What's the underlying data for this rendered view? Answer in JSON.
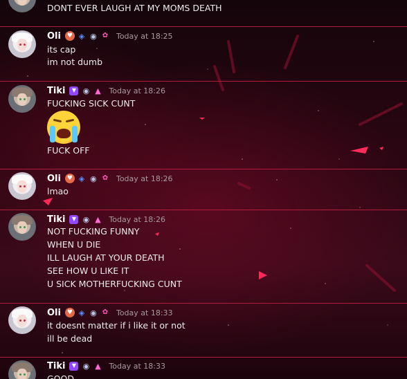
{
  "messages": [
    {
      "author": "",
      "timestamp": "",
      "lines": [
        "DONT EVER LAUGH AT MY MOMS DEATH"
      ],
      "avatar": "tiki"
    },
    {
      "author": "Oli",
      "timestamp": "Today at 18:25",
      "lines": [
        "its cap",
        "im not dumb"
      ],
      "avatar": "oli",
      "badges": [
        "heart-badge-icon",
        "developer-badge-icon",
        "eye-badge-icon",
        "gem-badge-icon"
      ]
    },
    {
      "author": "Tiki",
      "timestamp": "Today at 18:26",
      "lines": [
        "FUCKING SICK CUNT",
        "FUCK OFF"
      ],
      "avatar": "tiki",
      "badges": [
        "twitch-badge-icon",
        "eye-badge-icon",
        "triangle-badge-icon"
      ],
      "emoji": "loudly-crying-face-emoji"
    },
    {
      "author": "Oli",
      "timestamp": "Today at 18:26",
      "lines": [
        "lmao"
      ],
      "avatar": "oli",
      "badges": [
        "heart-badge-icon",
        "developer-badge-icon",
        "eye-badge-icon",
        "gem-badge-icon"
      ]
    },
    {
      "author": "Tiki",
      "timestamp": "Today at 18:26",
      "lines": [
        "NOT FUCKING FUNNY",
        "WHEN U DIE",
        "ILL LAUGH AT YOUR DEATH",
        "SEE HOW U LIKE IT",
        "U SICK MOTHERFUCKING CUNT"
      ],
      "avatar": "tiki",
      "badges": [
        "twitch-badge-icon",
        "eye-badge-icon",
        "triangle-badge-icon"
      ]
    },
    {
      "author": "Oli",
      "timestamp": "Today at 18:33",
      "lines": [
        "it doesnt matter if i like it or not",
        "ill be dead"
      ],
      "avatar": "oli",
      "badges": [
        "heart-badge-icon",
        "developer-badge-icon",
        "eye-badge-icon",
        "gem-badge-icon"
      ]
    },
    {
      "author": "Tiki",
      "timestamp": "Today at 18:33",
      "lines": [
        "GOOD"
      ],
      "avatar": "tiki",
      "badges": [
        "twitch-badge-icon",
        "eye-badge-icon",
        "triangle-badge-icon"
      ]
    }
  ],
  "theme": {
    "divider": "#b21c3c",
    "accent": "#ff2a5a",
    "background": "#2a0612"
  }
}
